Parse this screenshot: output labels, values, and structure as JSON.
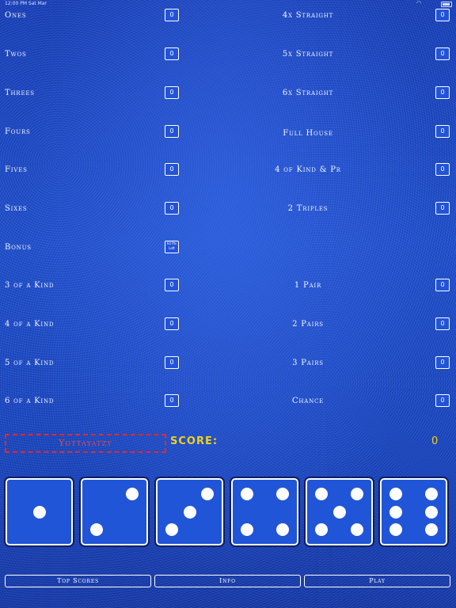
{
  "status_bar": {
    "time": "12:00 PM  Sat Mar",
    "battery_pct": "100%"
  },
  "left_categories": [
    {
      "label": "Ones",
      "value": "0"
    },
    {
      "label": "Twos",
      "value": "0"
    },
    {
      "label": "Threes",
      "value": "0"
    },
    {
      "label": "Fours",
      "value": "0"
    },
    {
      "label": "Fives",
      "value": "0"
    },
    {
      "label": "Sixes",
      "value": "0"
    },
    {
      "label": "Bonus",
      "value": "64 Pts Left"
    },
    {
      "label": "3 of a Kind",
      "value": "0"
    },
    {
      "label": "4 of a Kind",
      "value": "0"
    },
    {
      "label": "5 of a Kind",
      "value": "0"
    },
    {
      "label": "6 of a Kind",
      "value": "0"
    }
  ],
  "right_categories": [
    {
      "label": "4x Straight",
      "value": "0"
    },
    {
      "label": "5x Straight",
      "value": "0"
    },
    {
      "label": "6x Straight",
      "value": "0"
    },
    {
      "label": "Full House",
      "value": "0"
    },
    {
      "label": "4 of Kind & Pr",
      "value": "0"
    },
    {
      "label": "2 Triples",
      "value": "0"
    },
    {
      "label": "1 Pair",
      "value": "0"
    },
    {
      "label": "2 Pairs",
      "value": "0"
    },
    {
      "label": "3 Pairs",
      "value": "0"
    },
    {
      "label": "Chance",
      "value": "0"
    }
  ],
  "yottayatzy_label": "Yottayatzy",
  "score": {
    "label": "SCORE:",
    "value": "0"
  },
  "dice": [
    1,
    2,
    3,
    4,
    5,
    6
  ],
  "buttons": {
    "top_scores": "Top Scores",
    "info": "Info",
    "play": "Play"
  },
  "colors": {
    "felt": "#1f4fcf",
    "score": "#f1d11b",
    "yottayatzy": "#e02a2a"
  }
}
